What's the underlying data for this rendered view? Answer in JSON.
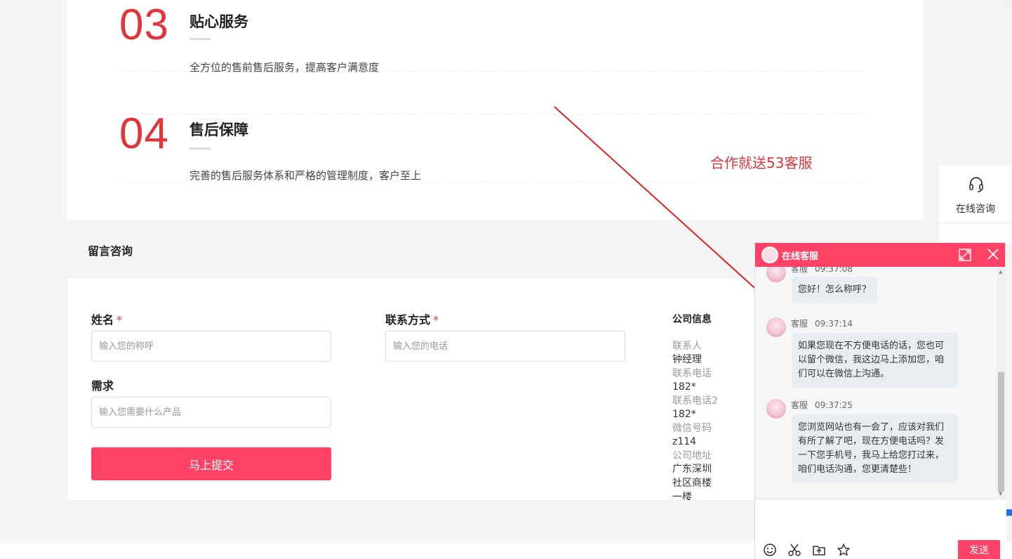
{
  "features": [
    {
      "num": "03",
      "title": "贴心服务",
      "desc": "全方位的售前售后服务，提高客户满意度"
    },
    {
      "num": "04",
      "title": "售后保障",
      "desc": "完善的售后服务体系和严格的管理制度，客户至上"
    }
  ],
  "annotation": "合作就送53客服",
  "message": {
    "section_title": "留言咨询",
    "name_label": "姓名",
    "name_placeholder": "输入您的称呼",
    "contact_label": "联系方式",
    "contact_placeholder": "输入您的电话",
    "need_label": "需求",
    "need_placeholder": "输入您需要什么产品",
    "required_mark": "*",
    "submit_label": "马上提交"
  },
  "company": {
    "title": "公司信息",
    "rows": [
      {
        "key": "联系人",
        "value": "钟经理"
      },
      {
        "key": "联系电话",
        "value": "182*"
      },
      {
        "key": "联系电话2",
        "value": "182*"
      },
      {
        "key": "微信号码",
        "value": "z114"
      },
      {
        "key": "公司地址",
        "value": "广东深圳社区商楼一楼"
      }
    ]
  },
  "sidebar": {
    "consult_label": "在线咨询",
    "consult_icon": "headset-icon"
  },
  "chat": {
    "title": "在线客服",
    "messages": [
      {
        "sender": "客服",
        "time": "09:37:08",
        "text": "您好！怎么称呼？"
      },
      {
        "sender": "客服",
        "time": "09:37:14",
        "text": "如果您现在不方便电话的话，您也可以留个微信，我这边马上添加您，咱们可以在微信上沟通。"
      },
      {
        "sender": "客服",
        "time": "09:37:25",
        "text": "您浏览网站也有一会了，应该对我们有所了解了吧，现在方便电话吗？发一下您手机号，我马上给您打过来，咱们电话沟通，您更清楚些！"
      }
    ],
    "send_label": "发送"
  },
  "colors": {
    "accent": "#ff4266",
    "number_red": "#e1343b"
  }
}
